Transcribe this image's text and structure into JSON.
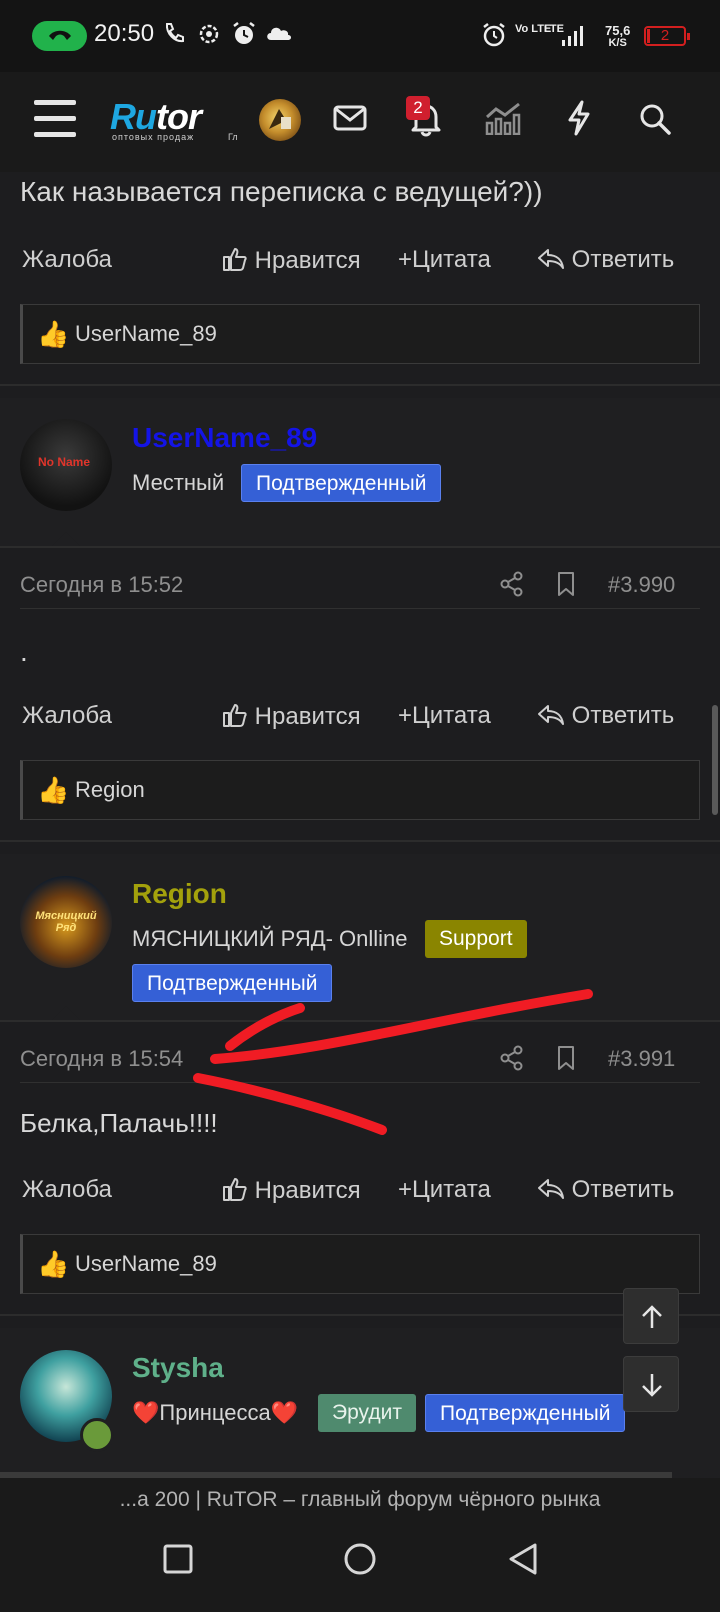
{
  "status_bar": {
    "time": "20:50",
    "network": "LTE",
    "network_2": "Vo LTE",
    "net_speed_value": "75,6",
    "net_speed_unit": "K/S",
    "battery": "2"
  },
  "header": {
    "logo_ru": "Ru",
    "logo_tor": "tor",
    "logo_subtitle": "оптовых продаж",
    "logo_subtitle_2": "Гл",
    "notifications_count": "2",
    "icons": [
      "menu-icon",
      "mail-icon",
      "bell-icon",
      "chart-icon",
      "lightning-icon",
      "search-icon"
    ]
  },
  "actions": {
    "report": "Жалоба",
    "like": "Нравится",
    "quote": "Цитата",
    "reply": "Ответить"
  },
  "prev_post": {
    "text": "Как называется переписка с ведущей?))",
    "reaction_user": "UserName_89"
  },
  "posts": [
    {
      "username": "UserName_89",
      "username_color": "#1414e6",
      "avatar_text": "No Name",
      "title": "Местный",
      "badges": [
        "Подтвержденный"
      ],
      "date": "Сегодня в 15:52",
      "number": "#3.990",
      "text": ".",
      "reaction_user": "Region"
    },
    {
      "username": "Region",
      "username_color": "#a3a10c",
      "avatar_text": "Мясницкий Ряд",
      "title": "МЯСНИЦКИЙ РЯД- Onlline",
      "badges": [
        "Support",
        "Подтвержденный"
      ],
      "date": "Сегодня в 15:54",
      "number": "#3.991",
      "text": "Белка,Палачь!!!!",
      "reaction_user": "UserName_89"
    },
    {
      "username": "Stysha",
      "username_color": "#5fb08a",
      "title": "❤️Принцесса❤️",
      "badges": [
        "Эрудит",
        "Подтвержденный"
      ]
    }
  ],
  "footer": {
    "page_title": "...а 200 | RuTOR – главный форум чёрного рынка"
  },
  "colors": {
    "background": "#1d1d1f",
    "confirmed_badge": "#3560d6",
    "support_badge": "#8a8500",
    "annotation": "#f01c24"
  }
}
